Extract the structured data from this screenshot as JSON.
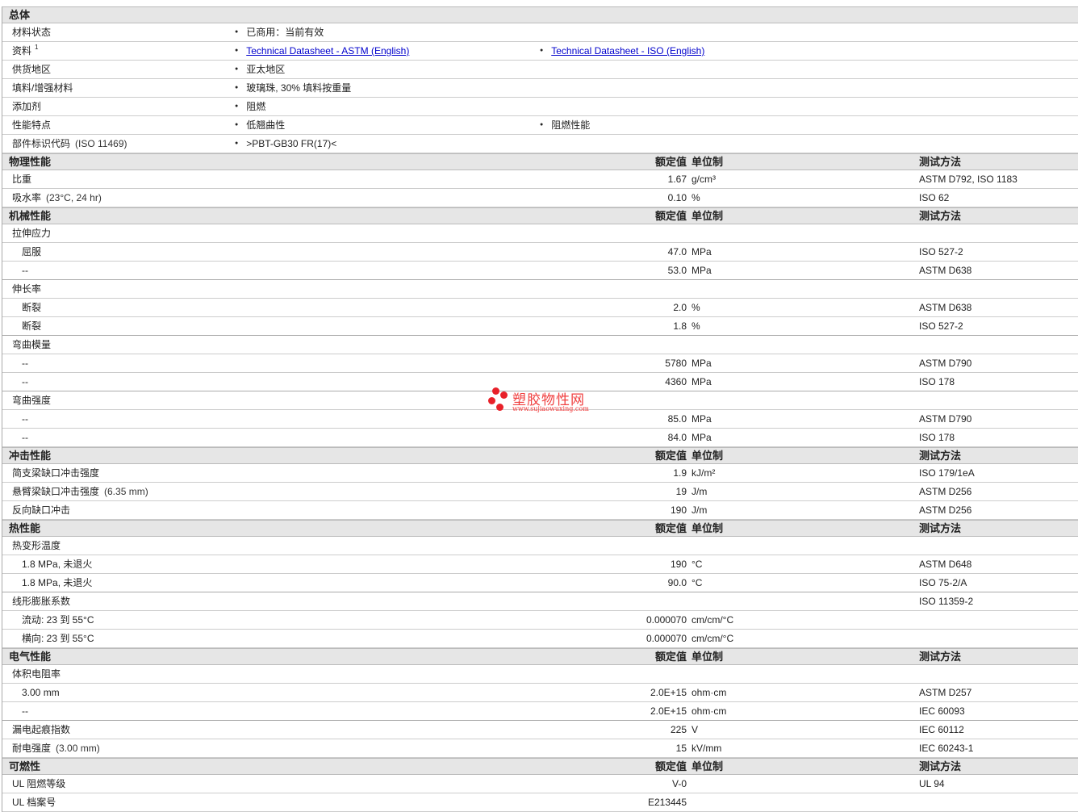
{
  "sections": [
    {
      "title": "总体",
      "general": true,
      "rows": [
        {
          "label": "材料状态",
          "items": [
            "已商用：当前有效"
          ]
        },
        {
          "label": "资料",
          "sup": "1",
          "items": [
            "Technical Datasheet - ASTM (English)",
            "Technical Datasheet - ISO (English)"
          ],
          "links": true
        },
        {
          "label": "供货地区",
          "items": [
            "亚太地区"
          ]
        },
        {
          "label": "填料/增强材料",
          "items": [
            "玻璃珠, 30% 填料按重量"
          ]
        },
        {
          "label": "添加剂",
          "items": [
            "阻燃"
          ]
        },
        {
          "label": "性能特点",
          "items": [
            "低翘曲性",
            "阻燃性能"
          ]
        },
        {
          "label": "部件标识代码",
          "note": "(ISO 11469)",
          "items": [
            ">PBT-GB30 FR(17)<"
          ]
        }
      ]
    },
    {
      "title": "物理性能",
      "col_value": "额定值",
      "col_unit": "单位制",
      "col_test": "测试方法",
      "rows": [
        {
          "label": "比重",
          "value": "1.67",
          "unit": "g/cm³",
          "test": "ASTM D792, ISO 1183"
        },
        {
          "label": "吸水率",
          "note": "(23°C, 24 hr)",
          "value": "0.10",
          "unit": "%",
          "test": "ISO 62"
        }
      ]
    },
    {
      "title": "机械性能",
      "col_value": "额定值",
      "col_unit": "单位制",
      "col_test": "测试方法",
      "rows": [
        {
          "label": "拉伸应力"
        },
        {
          "label": "屈服",
          "sub": true,
          "value": "47.0",
          "unit": "MPa",
          "test": "ISO 527-2"
        },
        {
          "label": "--",
          "sub": true,
          "value": "53.0",
          "unit": "MPa",
          "test": "ASTM D638",
          "end": true
        },
        {
          "label": "伸长率"
        },
        {
          "label": "断裂",
          "sub": true,
          "value": "2.0",
          "unit": "%",
          "test": "ASTM D638"
        },
        {
          "label": "断裂",
          "sub": true,
          "value": "1.8",
          "unit": "%",
          "test": "ISO 527-2",
          "end": true
        },
        {
          "label": "弯曲模量"
        },
        {
          "label": "--",
          "sub": true,
          "value": "5780",
          "unit": "MPa",
          "test": "ASTM D790"
        },
        {
          "label": "--",
          "sub": true,
          "value": "4360",
          "unit": "MPa",
          "test": "ISO 178",
          "end": true
        },
        {
          "label": "弯曲强度"
        },
        {
          "label": "--",
          "sub": true,
          "value": "85.0",
          "unit": "MPa",
          "test": "ASTM D790"
        },
        {
          "label": "--",
          "sub": true,
          "value": "84.0",
          "unit": "MPa",
          "test": "ISO 178"
        }
      ]
    },
    {
      "title": "冲击性能",
      "col_value": "额定值",
      "col_unit": "单位制",
      "col_test": "测试方法",
      "rows": [
        {
          "label": "简支梁缺口冲击强度",
          "value": "1.9",
          "unit": "kJ/m²",
          "test": "ISO 179/1eA"
        },
        {
          "label": "悬臂梁缺口冲击强度",
          "note": "(6.35 mm)",
          "value": "19",
          "unit": "J/m",
          "test": "ASTM D256"
        },
        {
          "label": "反向缺口冲击",
          "value": "190",
          "unit": "J/m",
          "test": "ASTM D256"
        }
      ]
    },
    {
      "title": "热性能",
      "col_value": "额定值",
      "col_unit": "单位制",
      "col_test": "测试方法",
      "rows": [
        {
          "label": "热变形温度"
        },
        {
          "label": "1.8 MPa, 未退火",
          "sub": true,
          "value": "190",
          "unit": "°C",
          "test": "ASTM D648"
        },
        {
          "label": "1.8 MPa, 未退火",
          "sub": true,
          "value": "90.0",
          "unit": "°C",
          "test": "ISO 75-2/A",
          "end": true
        },
        {
          "label": "线形膨胀系数",
          "test": "ISO 11359-2"
        },
        {
          "label": "流动: 23 到  55°C",
          "sub": true,
          "value": "0.000070",
          "unit": "cm/cm/°C"
        },
        {
          "label": "横向: 23 到  55°C",
          "sub": true,
          "value": "0.000070",
          "unit": "cm/cm/°C"
        }
      ]
    },
    {
      "title": "电气性能",
      "col_value": "额定值",
      "col_unit": "单位制",
      "col_test": "测试方法",
      "rows": [
        {
          "label": "体积电阻率"
        },
        {
          "label": "3.00 mm",
          "sub": true,
          "value": "2.0E+15",
          "unit": "ohm·cm",
          "test": "ASTM D257"
        },
        {
          "label": "--",
          "sub": true,
          "value": "2.0E+15",
          "unit": "ohm·cm",
          "test": "IEC 60093",
          "end": true
        },
        {
          "label": "漏电起痕指数",
          "value": "225",
          "unit": "V",
          "test": "IEC 60112"
        },
        {
          "label": "耐电强度",
          "note": "(3.00 mm)",
          "value": "15",
          "unit": "kV/mm",
          "test": "IEC 60243-1"
        }
      ]
    },
    {
      "title": "可燃性",
      "col_value": "额定值",
      "col_unit": "单位制",
      "col_test": "测试方法",
      "rows": [
        {
          "label": "UL 阻燃等级",
          "value": "V-0",
          "test": "UL 94"
        },
        {
          "label": "UL 档案号",
          "value": "E213445"
        }
      ]
    }
  ],
  "watermark": {
    "title": "塑胶物性网",
    "url": "www.sujiaowuxing.com"
  }
}
